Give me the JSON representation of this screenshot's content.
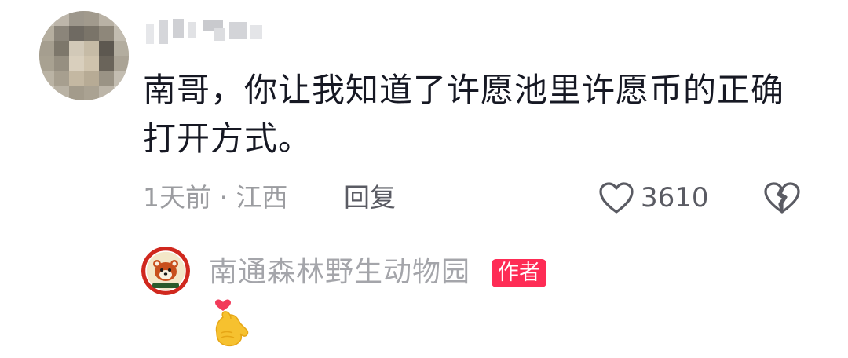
{
  "comment": {
    "username": "",
    "text": "南哥，你让我知道了许愿池里许愿币的正确打开方式。",
    "time": "1天前",
    "location": "江西",
    "meta_separator": " · ",
    "reply_label": "回复",
    "like_count": "3610",
    "icons": {
      "avatar": "pixelated-avatar",
      "like": "heart-outline-icon",
      "dislike": "broken-heart-icon"
    }
  },
  "author_reply": {
    "name": "南通森林野生动物园",
    "badge": "作者",
    "emoji": "finger-heart-emoji",
    "avatar": "red-panda-logo"
  },
  "colors": {
    "text_primary": "#161823",
    "text_secondary": "#9b9ca0",
    "accent": "#fe2c55"
  }
}
